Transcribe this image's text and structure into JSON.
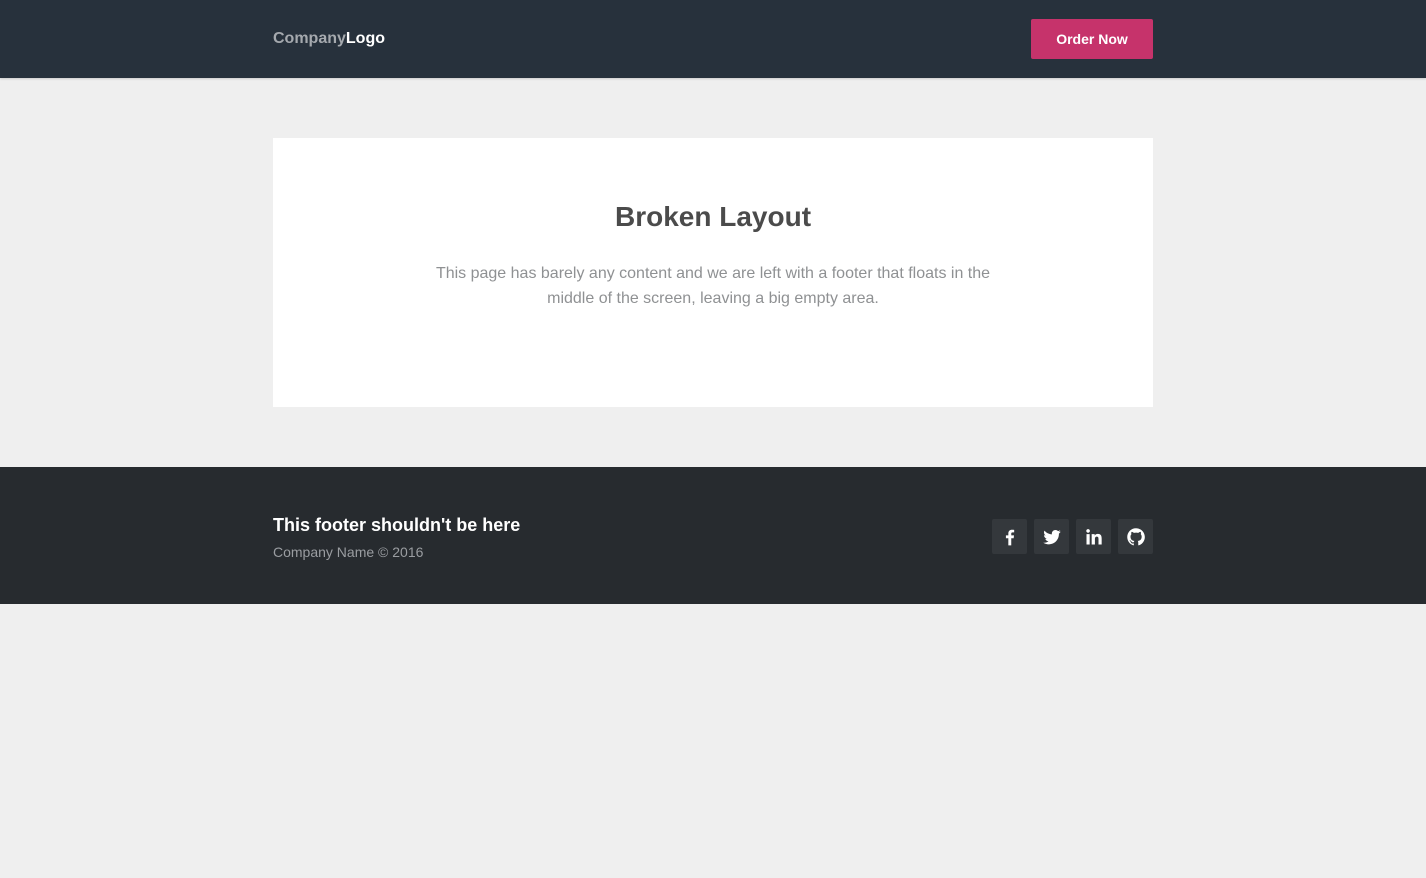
{
  "header": {
    "logo_company": "Company",
    "logo_logo": "Logo",
    "order_button": "Order Now"
  },
  "main": {
    "title": "Broken Layout",
    "description": "This page has barely any content and we are left with a footer that floats in the middle of the screen, leaving a big empty area."
  },
  "footer": {
    "title": "This footer shouldn't be here",
    "copyright": "Company Name © 2016",
    "socials": [
      {
        "icon": "facebook-icon"
      },
      {
        "icon": "twitter-icon"
      },
      {
        "icon": "linkedin-icon"
      },
      {
        "icon": "github-icon"
      }
    ]
  },
  "colors": {
    "header_bg": "#27313c",
    "accent": "#c6336b",
    "page_bg": "#efefef",
    "footer_bg": "#272b2f"
  }
}
